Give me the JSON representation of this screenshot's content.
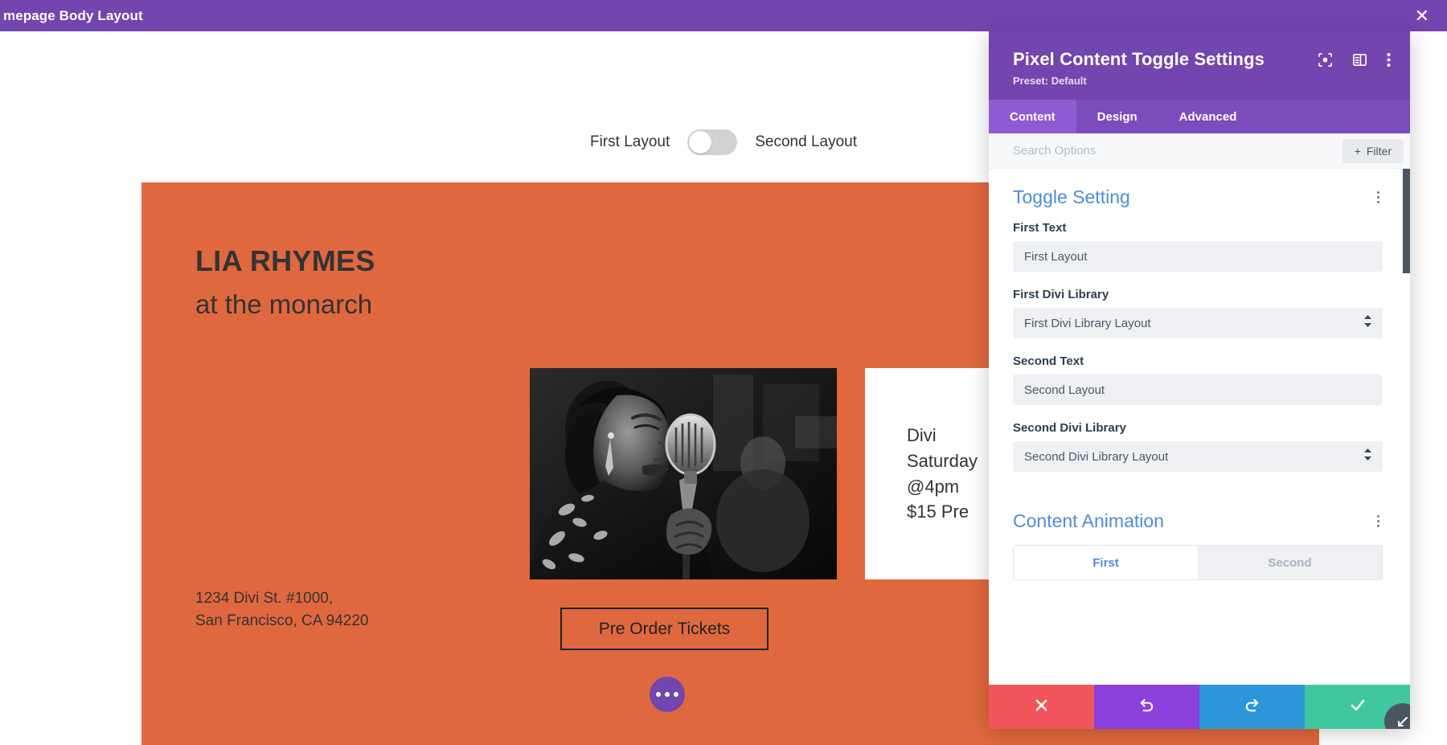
{
  "topbar": {
    "title": "mepage Body Layout",
    "close_icon": "close-icon",
    "bg": "#7245af"
  },
  "canvas": {
    "toggle": {
      "first_label": "First Layout",
      "second_label": "Second Layout",
      "state": "first"
    },
    "hero": {
      "bg": "#e0683e",
      "title": "LIA RHYMES",
      "subtitle": "at the monarch",
      "address": "1234 Divi St. #1000,\nSan Francisco, CA 94220",
      "photo_alt": "singer-at-microphone-photo",
      "info_card_text": "Divi\nSaturday\n@4pm\n$15 Pre",
      "cta_label": "Pre Order Tickets",
      "fab_icon": "ellipsis-icon"
    }
  },
  "modal": {
    "title": "Pixel Content Toggle Settings",
    "preset": "Preset: Default",
    "header_icons": [
      "focus-target-icon",
      "panel-layout-icon",
      "more-vertical-icon"
    ],
    "tabs": [
      {
        "label": "Content",
        "active": true
      },
      {
        "label": "Design",
        "active": false
      },
      {
        "label": "Advanced",
        "active": false
      }
    ],
    "search": {
      "placeholder": "Search Options",
      "value": "",
      "filter_label": "Filter",
      "filter_icon": "plus-icon"
    },
    "sections": [
      {
        "title": "Toggle Setting",
        "menu_icon": "more-vertical-icon",
        "fields": [
          {
            "type": "text",
            "label": "First Text",
            "value": "First Layout"
          },
          {
            "type": "select",
            "label": "First Divi Library",
            "value": "First Divi Library Layout"
          },
          {
            "type": "text",
            "label": "Second Text",
            "value": "Second Layout"
          },
          {
            "type": "select",
            "label": "Second Divi Library",
            "value": "Second Divi Library Layout"
          }
        ]
      },
      {
        "title": "Content Animation",
        "menu_icon": "more-vertical-icon",
        "segments": [
          {
            "label": "First",
            "active": true
          },
          {
            "label": "Second",
            "active": false
          }
        ]
      }
    ],
    "footer": [
      {
        "name": "cancel",
        "icon": "close-icon",
        "color": "#f0565b"
      },
      {
        "name": "undo",
        "icon": "undo-icon",
        "color": "#8b3fdb"
      },
      {
        "name": "redo",
        "icon": "redo-icon",
        "color": "#2b96d8"
      },
      {
        "name": "save",
        "icon": "check-icon",
        "color": "#41c7a0"
      }
    ],
    "resize_icon": "resize-handle-icon"
  }
}
